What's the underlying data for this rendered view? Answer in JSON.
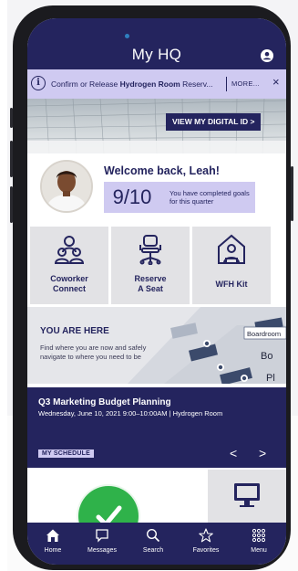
{
  "header": {
    "title": "My HQ",
    "profile_icon": "user-circle-icon"
  },
  "notification": {
    "text_prefix": "Confirm or Release ",
    "text_bold": "Hydrogen Room",
    "text_suffix": " Reserv...",
    "more_label": "MORE...",
    "close_glyph": "×"
  },
  "hero": {
    "button_label": "VIEW MY DIGITAL ID >"
  },
  "welcome": {
    "greeting": "Welcome back, Leah!",
    "goals_value": "9/10",
    "goals_text": "You have completed goals for this quarter"
  },
  "tiles": [
    {
      "label_line1": "Coworker",
      "label_line2": "Connect",
      "icon": "coworker-group-icon"
    },
    {
      "label_line1": "Reserve",
      "label_line2": "A Seat",
      "icon": "office-chair-icon"
    },
    {
      "label_line1": "WFH Kit",
      "label_line2": "",
      "icon": "home-worker-icon"
    }
  ],
  "map": {
    "heading": "YOU ARE HERE",
    "text": "Find where you are now and safely navigate to where you need to be",
    "label_room": "Boardroom",
    "label_b": "Bo",
    "label_p": "Pl"
  },
  "meeting": {
    "title": "Q3 Marketing Budget Planning",
    "details": "Wednesday, June 10, 2021  9:00–10:00AM | Hydrogen Room",
    "schedule_label": "MY SCHEDULE",
    "prev_glyph": "<",
    "next_glyph": ">"
  },
  "tabs": [
    {
      "label": "Home",
      "icon": "home-icon"
    },
    {
      "label": "Messages",
      "icon": "chat-bubble-icon"
    },
    {
      "label": "Search",
      "icon": "search-icon"
    },
    {
      "label": "Favorites",
      "icon": "star-icon"
    },
    {
      "label": "Menu",
      "icon": "grid-menu-icon"
    }
  ],
  "colors": {
    "navy": "#24245e",
    "lavender": "#cfcaf1",
    "green": "#2fb24a"
  }
}
